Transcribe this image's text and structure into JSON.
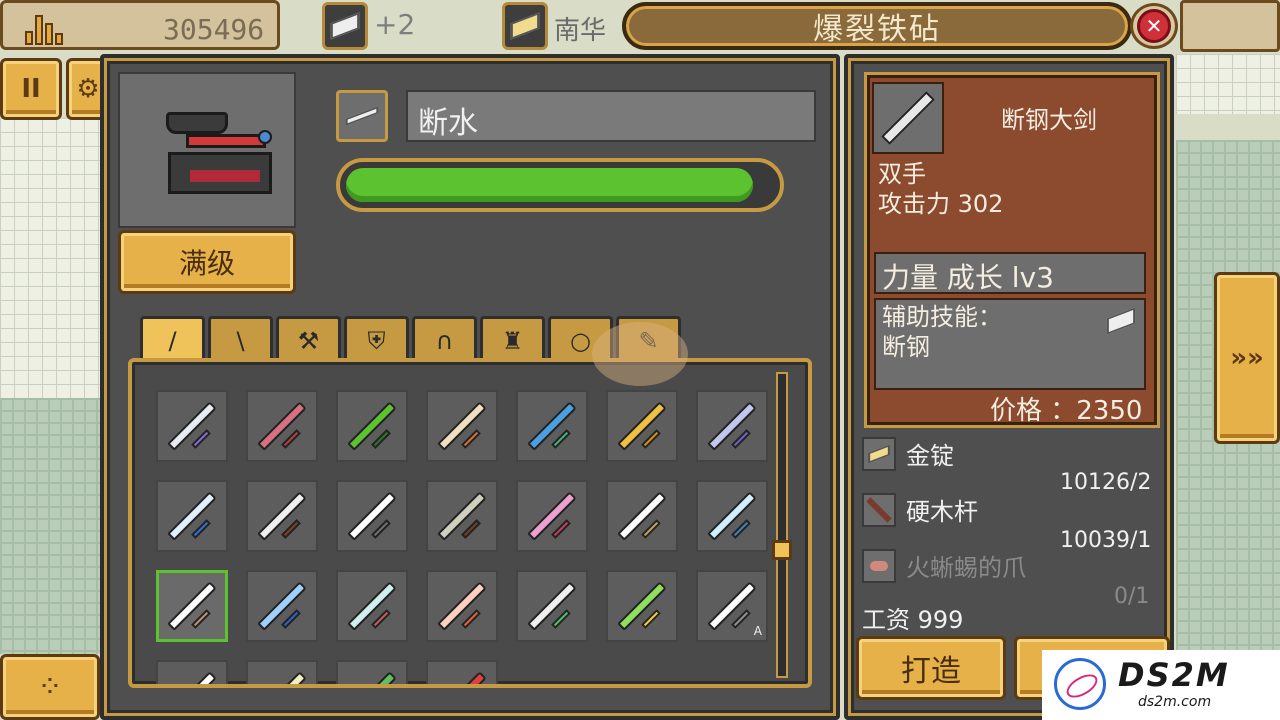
{
  "topbar": {
    "gold": "305496",
    "material_bonus": "+2",
    "material_partial": "南华",
    "title": "爆裂铁砧",
    "close_label": "✕"
  },
  "left_buttons": {
    "pause": "II",
    "dice": "⁘"
  },
  "forge": {
    "item_name": "断水",
    "progress_percent": 95,
    "max_level_label": "满级"
  },
  "tabs": [
    {
      "id": "sword",
      "icon": "sword-icon",
      "glyph": "/"
    },
    {
      "id": "spear",
      "icon": "spear-icon",
      "glyph": "\\"
    },
    {
      "id": "axe",
      "icon": "axe-icon",
      "glyph": "⚒"
    },
    {
      "id": "shield",
      "icon": "shield-icon",
      "glyph": "⛨"
    },
    {
      "id": "helmet",
      "icon": "helmet-icon",
      "glyph": "∩"
    },
    {
      "id": "armor",
      "icon": "armor-icon",
      "glyph": "♜"
    },
    {
      "id": "ring",
      "icon": "ring-icon",
      "glyph": "○"
    },
    {
      "id": "misc",
      "icon": "misc-icon",
      "glyph": "✎"
    }
  ],
  "items": [
    {
      "blade": "#e8ecf0",
      "guard": "#8a6ad0"
    },
    {
      "blade": "#d87080",
      "guard": "#b04040"
    },
    {
      "blade": "#5cc22f",
      "guard": "#2a7a2a"
    },
    {
      "blade": "#f0e0c0",
      "guard": "#d07040"
    },
    {
      "blade": "#4aa0e0",
      "guard": "#40b080"
    },
    {
      "blade": "#f0c040",
      "guard": "#d09020"
    },
    {
      "blade": "#c0c8f0",
      "guard": "#7060c0"
    },
    {
      "blade": "#e0f0ff",
      "guard": "#3070d0"
    },
    {
      "blade": "#f0f0f0",
      "guard": "#804020"
    },
    {
      "blade": "#ffffff",
      "guard": "#707070"
    },
    {
      "blade": "#d0d0c0",
      "guard": "#704020"
    },
    {
      "blade": "#f0a0d0",
      "guard": "#c04060"
    },
    {
      "blade": "#ffffff",
      "guard": "#c0a060"
    },
    {
      "blade": "#d0f0ff",
      "guard": "#4080c0"
    },
    {
      "blade": "#ffffff",
      "guard": "#c09070",
      "selected": true
    },
    {
      "blade": "#a0d0ff",
      "guard": "#3060c0"
    },
    {
      "blade": "#d0f0f0",
      "guard": "#c06060"
    },
    {
      "blade": "#ffd0c0",
      "guard": "#e06040"
    },
    {
      "blade": "#f0f0f0",
      "guard": "#50c060"
    },
    {
      "blade": "#90e060",
      "guard": "#f0d040"
    },
    {
      "blade": "#ffffff",
      "guard": "#909090",
      "badge": "A"
    },
    {
      "blade": "#ffffff",
      "guard": "#707070"
    },
    {
      "blade": "#f0f0c0",
      "guard": "#707070"
    },
    {
      "blade": "#60c060",
      "guard": "#3a7a3a"
    },
    {
      "blade": "#e04040",
      "guard": "#802020"
    }
  ],
  "detail": {
    "name": "断钢大剑",
    "hands": "双手",
    "attack": "攻击力 302",
    "strength": "力量 成长 lv3",
    "skill_title": "辅助技能：",
    "skill_name": "断钢",
    "price": "价格 ：2350"
  },
  "materials": [
    {
      "name": "金锭",
      "count": "10126/2",
      "icon": "gold-ingot-icon"
    },
    {
      "name": "硬木杆",
      "count": "10039/1",
      "icon": "wood-stick-icon"
    },
    {
      "name": "火蜥蜴的爪",
      "count": "0/1",
      "icon": "lizard-claw-icon",
      "dim": true
    }
  ],
  "wage": "工资 999",
  "forge_button": "打造",
  "nav_arrow": "»»",
  "logo": {
    "text": "DS2M",
    "sub": "ds2m.com"
  }
}
